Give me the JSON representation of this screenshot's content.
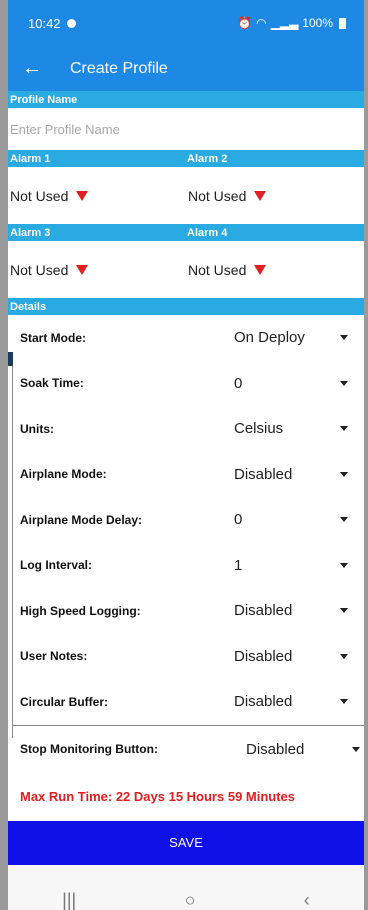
{
  "status": {
    "time": "10:42",
    "right": "100%"
  },
  "appbar": {
    "back_icon": "←",
    "title": "Create Profile"
  },
  "profile": {
    "header": "Profile Name",
    "placeholder": "Enter Profile Name"
  },
  "alarms": [
    {
      "header": "Alarm 1",
      "value": "Not Used"
    },
    {
      "header": "Alarm 2",
      "value": "Not Used"
    },
    {
      "header": "Alarm 3",
      "value": "Not Used"
    },
    {
      "header": "Alarm 4",
      "value": "Not Used"
    }
  ],
  "details": {
    "header": "Details",
    "rows": [
      {
        "label": "Start Mode:",
        "value": "On Deploy"
      },
      {
        "label": "Soak Time:",
        "value": "0"
      },
      {
        "label": "Units:",
        "value": "Celsius"
      },
      {
        "label": "Airplane Mode:",
        "value": "Disabled"
      },
      {
        "label": "Airplane Mode Delay:",
        "value": "0"
      },
      {
        "label": "Log Interval:",
        "value": "1"
      },
      {
        "label": "High Speed Logging:",
        "value": "Disabled"
      },
      {
        "label": "User Notes:",
        "value": "Disabled"
      },
      {
        "label": "Circular Buffer:",
        "value": "Disabled"
      }
    ],
    "stop": {
      "label": "Stop Monitoring Button:",
      "value": "Disabled"
    }
  },
  "max_run": "Max Run Time: 22 Days 15 Hours 59 Minutes",
  "save_label": "SAVE",
  "nav": {
    "recent": "|||",
    "home": "○",
    "back": "‹"
  },
  "colors": {
    "primary": "#1e88e5",
    "section": "#29abe2",
    "save": "#1010e8",
    "alert": "#e02020"
  }
}
